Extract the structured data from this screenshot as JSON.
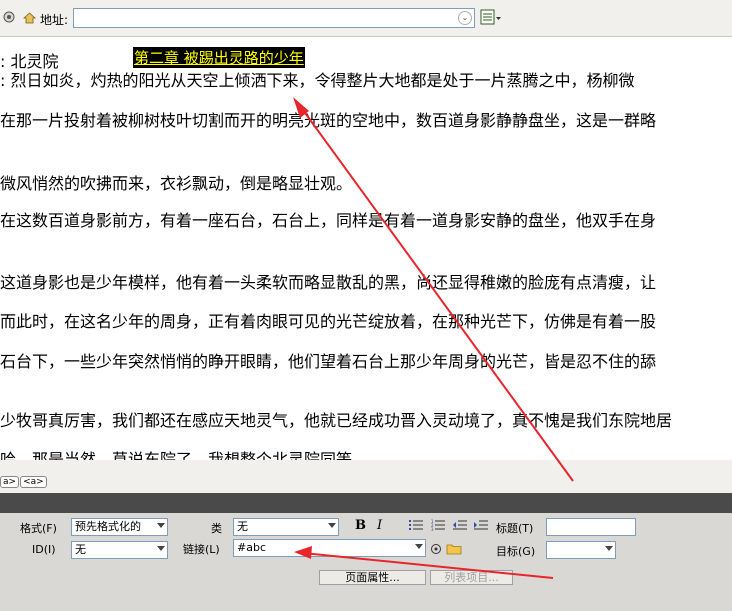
{
  "toolbar": {
    "address_label": "地址:",
    "address_value": ""
  },
  "document": {
    "line1_prefix": ":  北灵院",
    "heading": "第二章  被踢出灵路的少年",
    "lines": [
      ":   烈日如炎，灼热的阳光从天空上倾洒下来，令得整片大地都是处于一片蒸腾之中，杨柳微",
      "在那一片投射着被柳树枝叶切割而开的明亮光斑的空地中，数百道身影静静盘坐，这是一群略",
      "微风悄然的吹拂而来，衣衫飘动，倒是略显壮观。",
      "在这数百道身影前方，有着一座石台，石台上，同样是有着一道身影安静的盘坐，他双手在身",
      "这道身影也是少年模样，他有着一头柔软而略显散乱的黑，尚还显得稚嫩的脸庞有点清瘦，让",
      "而此时，在这名少年的周身，正有着肉眼可见的光芒绽放着，在那种光芒下，仿佛是有着一股",
      "石台下，一些少年突然悄悄的睁开眼睛，他们望着石台上那少年周身的光芒，皆是忍不住的舔",
      "少牧哥真厉害，我们都还在感应天地灵气，他就已经成功晋入灵动境了，真不愧是我们东院地居",
      "哈，那是当然，草说东院了，我想整个北灵院同等"
    ]
  },
  "tag_selector": {
    "tags": [
      "a>",
      "<a>"
    ]
  },
  "properties": {
    "format_label": "格式(F)",
    "format_value": "预先格式化的",
    "id_label": "ID(I)",
    "id_value": "无",
    "class_label": "类",
    "class_value": "无",
    "link_label": "链接(L)",
    "link_value": "#abc",
    "title_label": "标题(T)",
    "title_value": "",
    "target_label": "目标(G)",
    "target_value": "",
    "page_props_button": "页面属性...",
    "list_item_button": "列表项目..."
  },
  "colors": {
    "heading_bg": "#000000",
    "heading_fg": "#ffff00",
    "arrow": "#e8252b"
  }
}
